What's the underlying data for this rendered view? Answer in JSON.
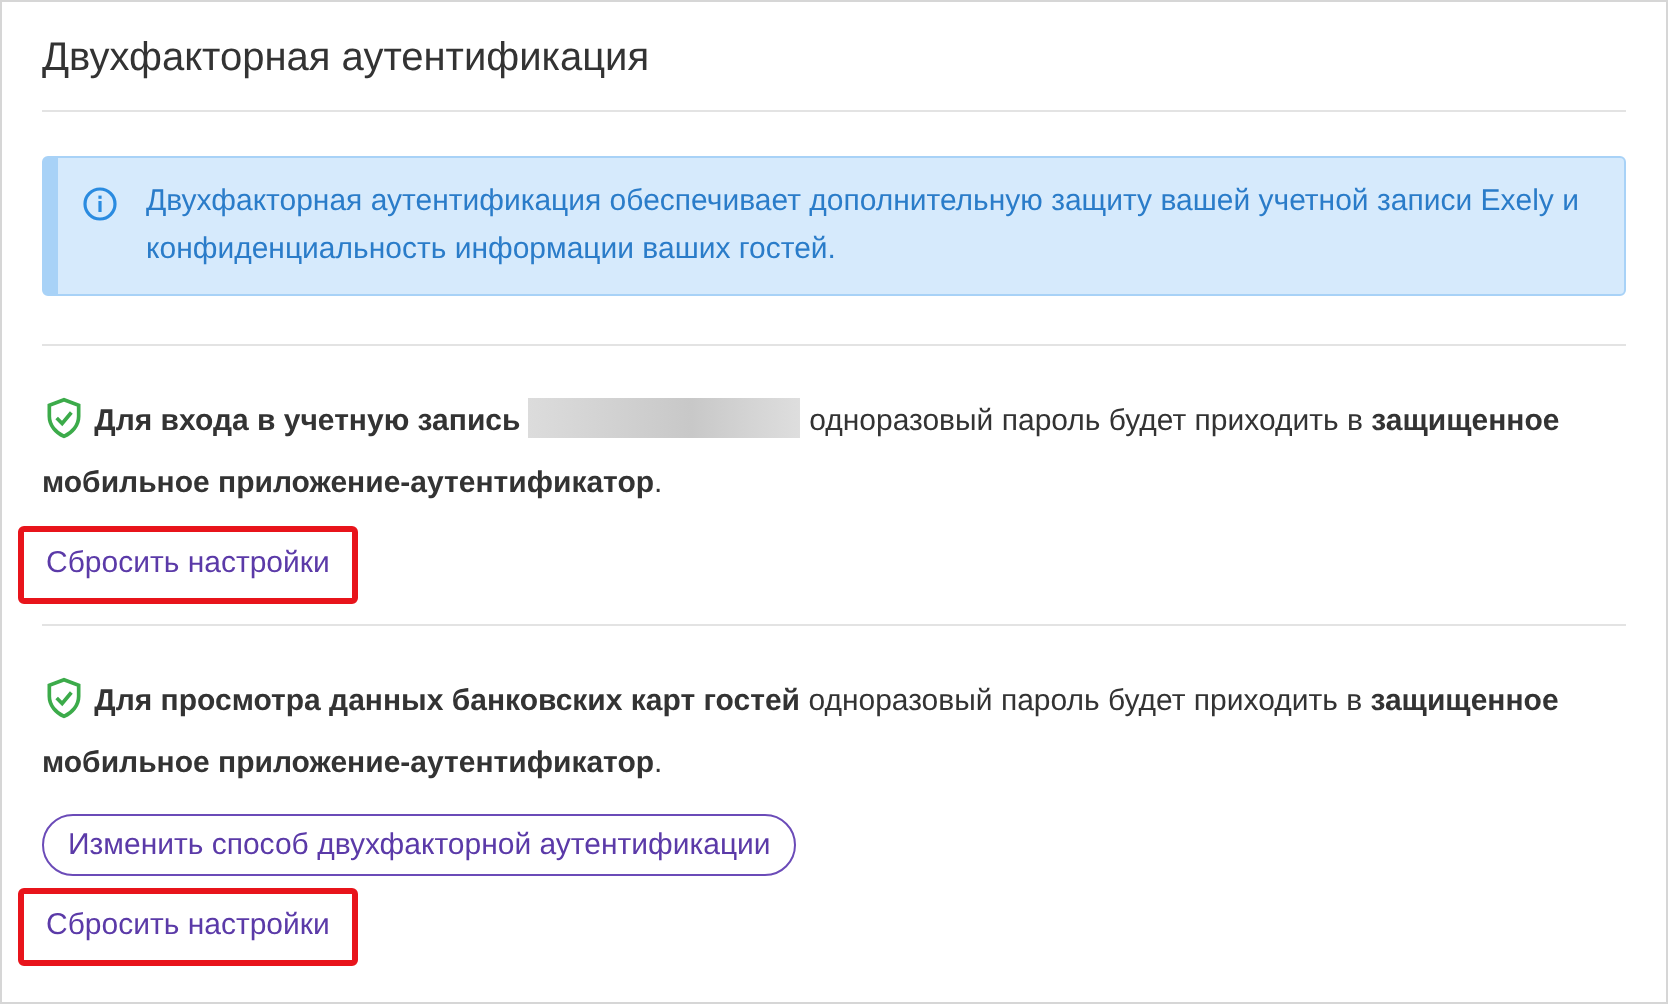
{
  "title": "Двухфакторная аутентификация",
  "alert": {
    "text": "Двухфакторная аутентификация обеспечивает дополнительную защиту вашей учетной записи Exely и конфиденциальность информации ваших гостей."
  },
  "sections": [
    {
      "lead": "Для входа в учетную запись",
      "redacted": true,
      "lines": [
        "одноразовый пароль будет приходить в **защищенное**",
        "**мобильное приложение-аутентификатор**."
      ],
      "link": {
        "label": "Сбросить настройки",
        "highlighted": true
      }
    },
    {
      "lead": "Для просмотра данных банковских карт гостей",
      "redacted": false,
      "lines": [
        "одноразовый пароль будет приходить в **защищенное**",
        "**мобильное приложение-аутентификатор**."
      ],
      "buttons": [
        "Изменить способ двухфакторной аутентификации"
      ],
      "link": {
        "label": "Сбросить настройки",
        "highlighted": true
      }
    }
  ]
}
